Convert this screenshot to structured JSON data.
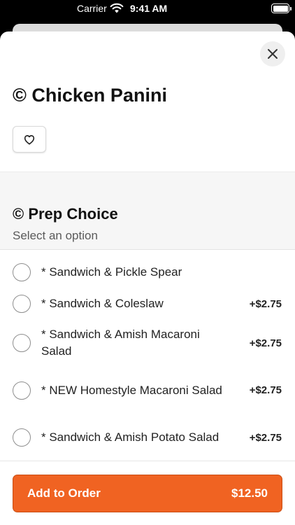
{
  "status_bar": {
    "carrier": "Carrier",
    "time": "9:41 AM"
  },
  "item": {
    "title": "© Chicken Panini"
  },
  "group": {
    "title": "© Prep Choice",
    "subtitle": "Select an option"
  },
  "options": [
    {
      "label": "* Sandwich & Pickle Spear",
      "price": ""
    },
    {
      "label": "* Sandwich & Coleslaw",
      "price": "+$2.75"
    },
    {
      "label": "* Sandwich & Amish Macaroni Salad",
      "price": "+$2.75"
    },
    {
      "label": "* NEW Homestyle Macaroni Salad",
      "price": "+$2.75"
    },
    {
      "label": "* Sandwich & Amish Potato Salad",
      "price": "+$2.75"
    }
  ],
  "footer": {
    "button_label": "Add to Order",
    "total": "$12.50"
  },
  "colors": {
    "accent": "#f06322",
    "sheet_background": "#ffffff",
    "group_background": "#f6f6f6"
  },
  "icons": {
    "close": "close-icon",
    "favorite": "heart-outline-icon",
    "wifi": "wifi-icon",
    "battery": "battery-icon"
  }
}
